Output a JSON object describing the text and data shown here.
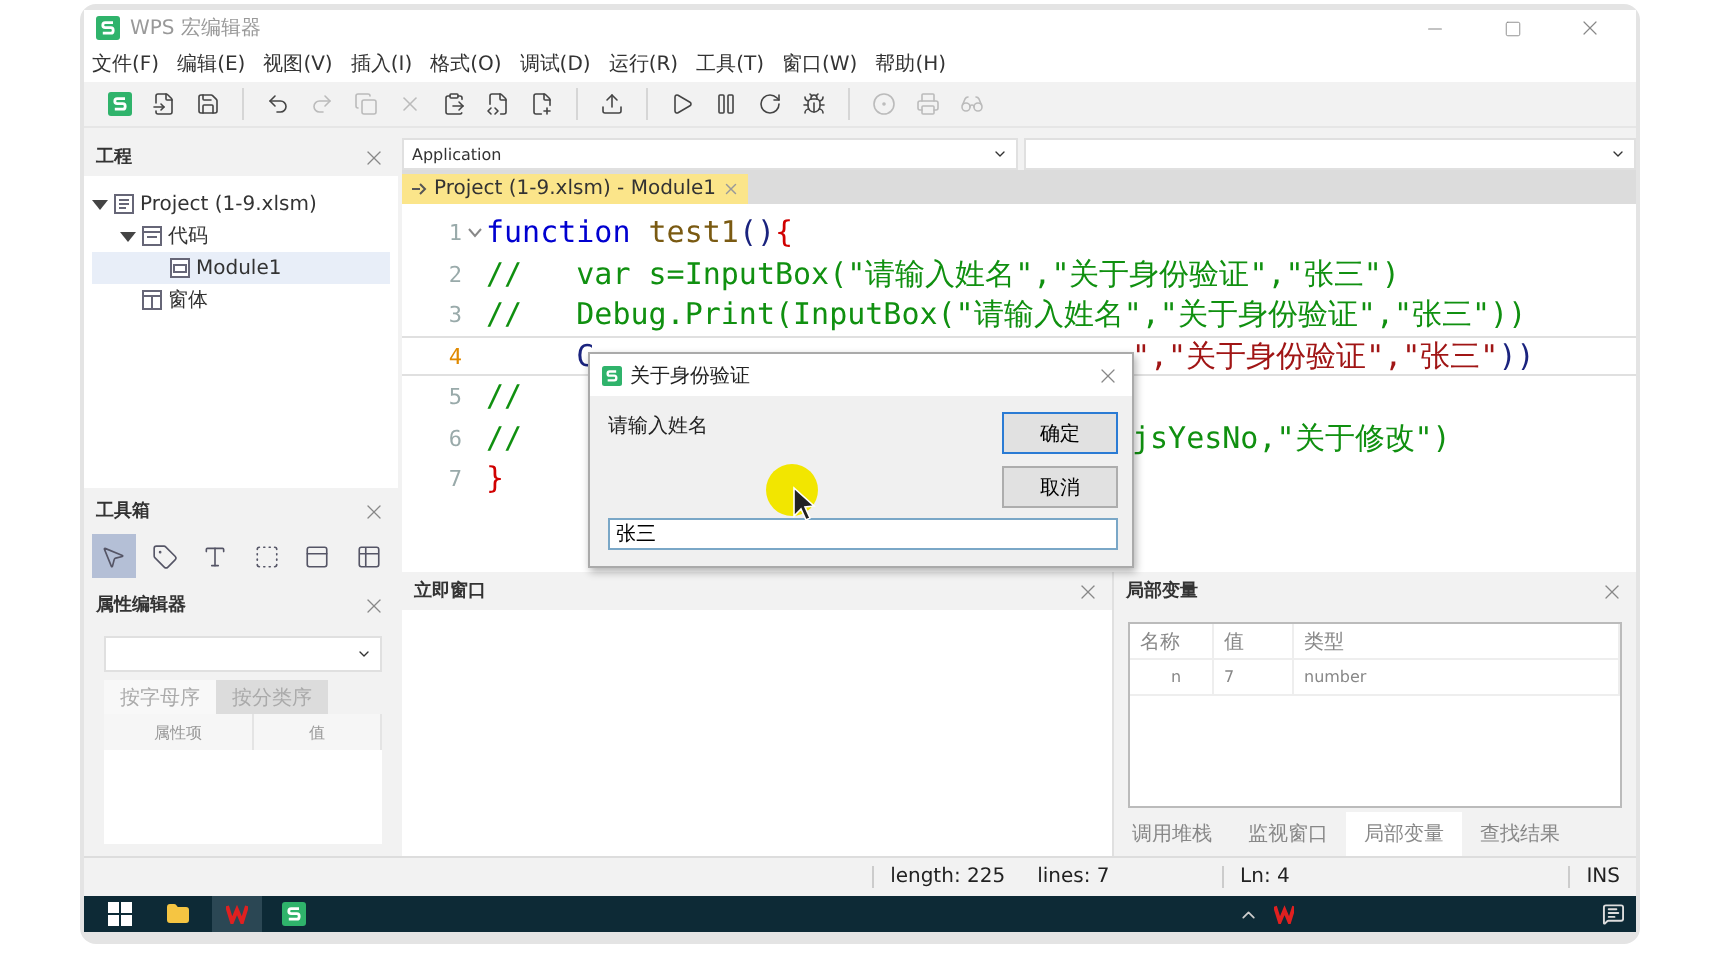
{
  "window": {
    "title": "WPS 宏编辑器"
  },
  "menu": [
    "文件(F)",
    "编辑(E)",
    "视图(V)",
    "插入(I)",
    "格式(O)",
    "调试(D)",
    "运行(R)",
    "工具(T)",
    "窗口(W)",
    "帮助(H)"
  ],
  "toolbar": [
    {
      "kind": "macro",
      "disabled": false
    },
    {
      "kind": "export",
      "disabled": false
    },
    {
      "kind": "save",
      "disabled": false
    },
    {
      "kind": "separator"
    },
    {
      "kind": "undo",
      "disabled": false
    },
    {
      "kind": "redo",
      "disabled": true
    },
    {
      "kind": "copy",
      "disabled": true
    },
    {
      "kind": "cut",
      "disabled": true
    },
    {
      "kind": "paste",
      "disabled": false
    },
    {
      "kind": "insert-module",
      "disabled": false
    },
    {
      "kind": "insert-form",
      "disabled": false
    },
    {
      "kind": "separator"
    },
    {
      "kind": "design",
      "disabled": false
    },
    {
      "kind": "separator"
    },
    {
      "kind": "run",
      "disabled": false
    },
    {
      "kind": "pause",
      "disabled": false
    },
    {
      "kind": "reset",
      "disabled": false
    },
    {
      "kind": "debug",
      "disabled": false
    },
    {
      "kind": "separator"
    },
    {
      "kind": "breakpoint",
      "disabled": true
    },
    {
      "kind": "step",
      "disabled": true
    },
    {
      "kind": "watch",
      "disabled": true
    }
  ],
  "project_panel": {
    "title": "工程",
    "tree": [
      {
        "label": "Project (1-9.xlsm)",
        "kind": "project",
        "selected": false,
        "expanded": true,
        "children": [
          {
            "label": "代码",
            "kind": "folder",
            "selected": false,
            "expanded": true,
            "children": [
              {
                "label": "Module1",
                "kind": "module",
                "selected": true
              }
            ]
          },
          {
            "label": "窗体",
            "kind": "form",
            "selected": false
          }
        ]
      }
    ]
  },
  "toolbox": {
    "title": "工具箱",
    "tools": [
      {
        "kind": "pointer",
        "selected": true
      },
      {
        "kind": "label",
        "selected": false
      },
      {
        "kind": "textbox",
        "selected": false
      },
      {
        "kind": "frame",
        "selected": false
      },
      {
        "kind": "panel",
        "selected": false
      },
      {
        "kind": "grid",
        "selected": false
      }
    ]
  },
  "property_editor": {
    "title": "属性编辑器",
    "tabs": [
      {
        "label": "按字母序",
        "selected": true
      },
      {
        "label": "按分类序",
        "selected": false
      }
    ],
    "columns": [
      "属性项",
      "值"
    ]
  },
  "editor": {
    "object_combo": "Application",
    "tab": "Project (1-9.xlsm) - Module1",
    "lines": [
      {
        "number": "1",
        "current": false,
        "left": [
          {
            "text": "function",
            "kind": "keyword"
          },
          {
            "text": " test1",
            "kind": "name"
          },
          {
            "text": "()",
            "kind": "punct"
          },
          {
            "text": "{",
            "kind": "brace"
          }
        ]
      },
      {
        "number": "2",
        "current": false,
        "left": [
          {
            "text": "//   var s=InputBox(\"请输入姓名\",\"关于身份验证\",\"张三\")",
            "kind": "comment"
          }
        ]
      },
      {
        "number": "3",
        "current": false,
        "left": [
          {
            "text": "//   Debug.Print(InputBox(\"请输入姓名\",\"关于身份验证\",\"张三\"))",
            "kind": "comment"
          }
        ]
      },
      {
        "number": "4",
        "current": true,
        "left": [
          {
            "text": "     C",
            "kind": "punct"
          }
        ],
        "right": [
          {
            "text": "\",\"关于身份验证\",\"张三\"",
            "kind": "string"
          },
          {
            "text": "))",
            "kind": "punct"
          }
        ]
      },
      {
        "number": "5",
        "current": false,
        "left": [
          {
            "text": "//",
            "kind": "comment"
          }
        ]
      },
      {
        "number": "6",
        "current": false,
        "left": [
          {
            "text": "//",
            "kind": "comment"
          }
        ],
        "right": [
          {
            "text": "jsYesNo,\"关于修改\")",
            "kind": "comment"
          }
        ]
      },
      {
        "number": "7",
        "current": false,
        "left": [
          {
            "text": "}",
            "kind": "brace"
          }
        ]
      }
    ]
  },
  "dialog": {
    "title": "关于身份验证",
    "prompt": "请输入姓名",
    "buttons": [
      {
        "label": "确定",
        "selected": true
      },
      {
        "label": "取消",
        "selected": false
      }
    ],
    "value": "张三"
  },
  "immediate_panel": {
    "title": "立即窗口"
  },
  "locals_panel": {
    "title": "局部变量",
    "columns": [
      "名称",
      "值",
      "类型"
    ],
    "rows": [
      {
        "name": "n",
        "value": "7",
        "type": "number"
      }
    ],
    "tabs": [
      {
        "label": "调用堆栈",
        "selected": false
      },
      {
        "label": "监视窗口",
        "selected": false
      },
      {
        "label": "局部变量",
        "selected": true
      },
      {
        "label": "查找结果",
        "selected": false
      }
    ]
  },
  "status_bar": {
    "length": "length: 225",
    "lines": "lines: 7",
    "position": "Ln: 4",
    "mode": "INS"
  },
  "taskbar": {
    "apps": [
      {
        "kind": "folder",
        "active": false
      },
      {
        "kind": "wps",
        "active": true
      },
      {
        "kind": "macro",
        "active": false
      }
    ]
  }
}
